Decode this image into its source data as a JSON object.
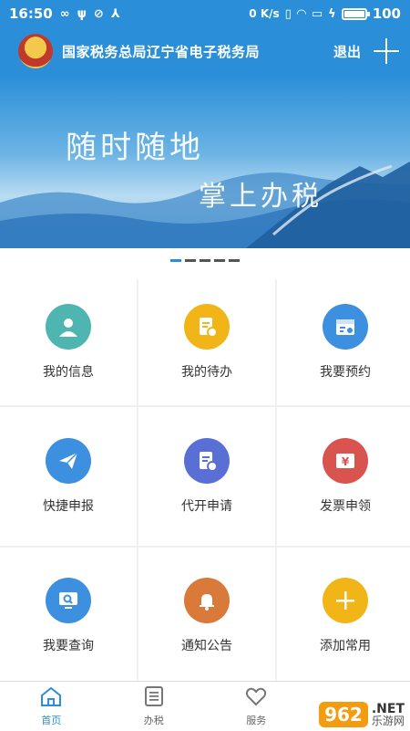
{
  "status_bar": {
    "time": "16:50",
    "network": "0 K/s",
    "battery": "100",
    "battery_level": 1.0
  },
  "header": {
    "title": "国家税务总局辽宁省电子税务局",
    "logout_label": "退出"
  },
  "banner": {
    "line1": "随时随地",
    "line2": "掌上办税"
  },
  "pager": {
    "count": 5,
    "active_index": 0
  },
  "grid": {
    "items": [
      {
        "label": "我的信息",
        "icon": "person-icon",
        "color": "#4fb5b0"
      },
      {
        "label": "我的待办",
        "icon": "todo-icon",
        "color": "#f2b517"
      },
      {
        "label": "我要预约",
        "icon": "calendar-icon",
        "color": "#3d8fe0"
      },
      {
        "label": "快捷申报",
        "icon": "paper-plane-icon",
        "color": "#3d8fe0"
      },
      {
        "label": "代开申请",
        "icon": "document-edit-icon",
        "color": "#5a6fd6"
      },
      {
        "label": "发票申领",
        "icon": "invoice-yen-icon",
        "color": "#d9534f"
      },
      {
        "label": "我要查询",
        "icon": "search-monitor-icon",
        "color": "#3d8fe0"
      },
      {
        "label": "通知公告",
        "icon": "bell-icon",
        "color": "#d97a3a"
      },
      {
        "label": "添加常用",
        "icon": "plus-icon",
        "color": "#f2b517"
      }
    ]
  },
  "tabbar": {
    "tabs": [
      {
        "label": "首页",
        "icon": "home-icon"
      },
      {
        "label": "办税",
        "icon": "list-icon"
      },
      {
        "label": "服务",
        "icon": "heart-icon"
      },
      {
        "label": "",
        "icon": ""
      }
    ]
  },
  "watermark": {
    "badge": "962",
    "net": ".NET",
    "cn": "乐游网"
  },
  "colors": {
    "primary": "#2a8fd8"
  }
}
